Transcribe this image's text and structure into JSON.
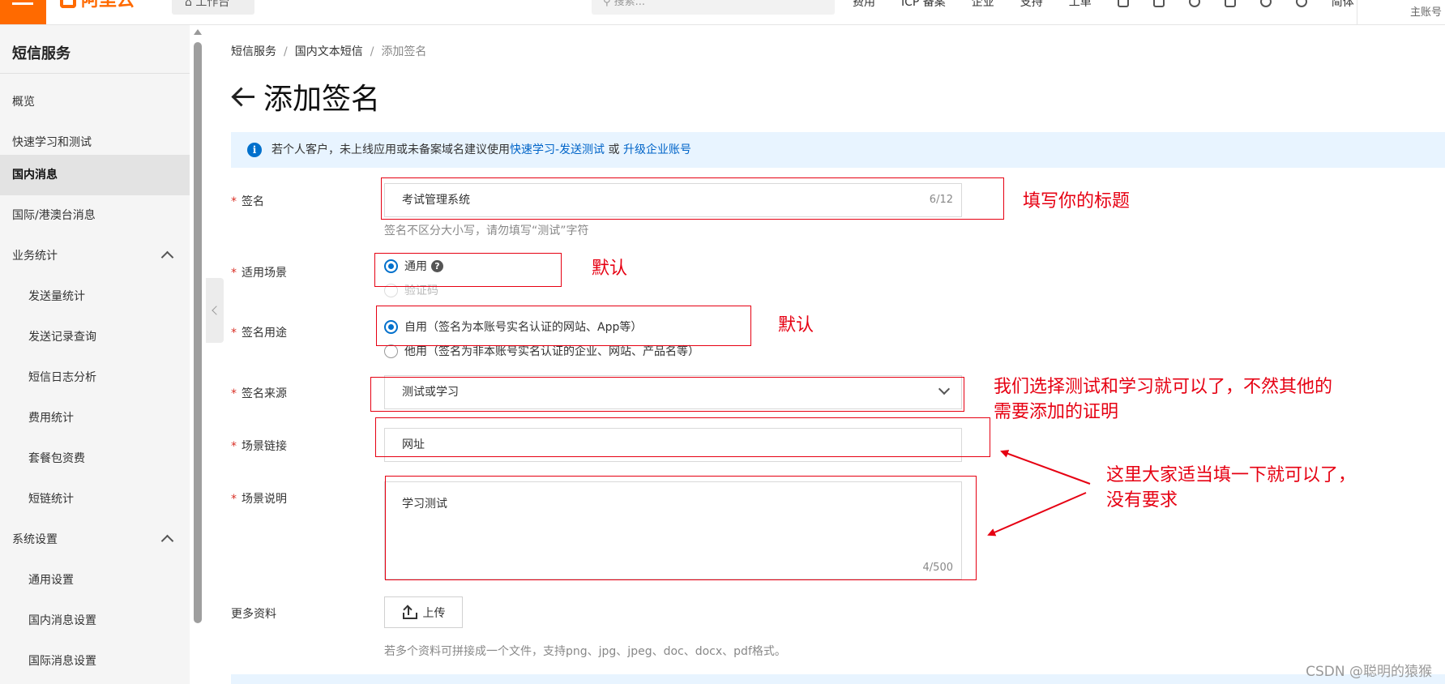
{
  "topbar": {
    "logo": "阿里云",
    "workbench": "工作台",
    "search_placeholder": "搜索...",
    "nav": [
      "费用",
      "ICP 备案",
      "企业",
      "支持",
      "工单"
    ],
    "language": "简体",
    "account": "主账号"
  },
  "sidebar": {
    "title": "短信服务",
    "items": [
      {
        "label": "概览"
      },
      {
        "label": "快速学习和测试"
      },
      {
        "label": "国内消息",
        "active": true
      },
      {
        "label": "国际/港澳台消息"
      },
      {
        "label": "业务统计",
        "expanded": true
      },
      {
        "label": "发送量统计"
      },
      {
        "label": "发送记录查询"
      },
      {
        "label": "短信日志分析"
      },
      {
        "label": "费用统计"
      },
      {
        "label": "套餐包资费"
      },
      {
        "label": "短链统计"
      },
      {
        "label": "系统设置",
        "expanded": true
      },
      {
        "label": "通用设置"
      },
      {
        "label": "国内消息设置"
      },
      {
        "label": "国际消息设置"
      }
    ]
  },
  "breadcrumb": [
    "短信服务",
    "国内文本短信",
    "添加签名"
  ],
  "page_title": "添加签名",
  "notice": {
    "text": "若个人客户，未上线应用或未备案域名建议使用",
    "link1": "快速学习-发送测试",
    "or": "或",
    "link2": "升级企业账号"
  },
  "form": {
    "signature": {
      "label": "签名",
      "value": "考试管理系统",
      "counter": "6/12",
      "hint": "签名不区分大小写，请勿填写“测试”字符"
    },
    "scene": {
      "label": "适用场景",
      "options": [
        "通用",
        "验证码"
      ],
      "selected": "通用"
    },
    "purpose": {
      "label": "签名用途",
      "options": [
        "自用（签名为本账号实名认证的网站、App等）",
        "他用（签名为非本账号实名认证的企业、网站、产品名等）"
      ],
      "selected": 0
    },
    "source": {
      "label": "签名来源",
      "value": "测试或学习"
    },
    "link": {
      "label": "场景链接",
      "value": "网址"
    },
    "description": {
      "label": "场景说明",
      "value": "学习测试",
      "counter": "4/500"
    },
    "more": {
      "label": "更多资料",
      "upload": "上传",
      "hint": "若多个资料可拼接成一个文件，支持png、jpg、jpeg、doc、docx、pdf格式。"
    }
  },
  "annotations": {
    "title_note": "填写你的标题",
    "scene_note": "默认",
    "purpose_note": "默认",
    "source_note_1": "我们选择测试和学习就可以了，不然其他的",
    "source_note_2": "需要添加的证明",
    "desc_note_1": "这里大家适当填一下就可以了，",
    "desc_note_2": "没有要求"
  },
  "watermark": "CSDN @聪明的猿猴",
  "colors": {
    "accent": "#ff6a00",
    "link": "#0064c8",
    "annotation": "#e60012",
    "notice_bg": "#e8f4ff"
  }
}
